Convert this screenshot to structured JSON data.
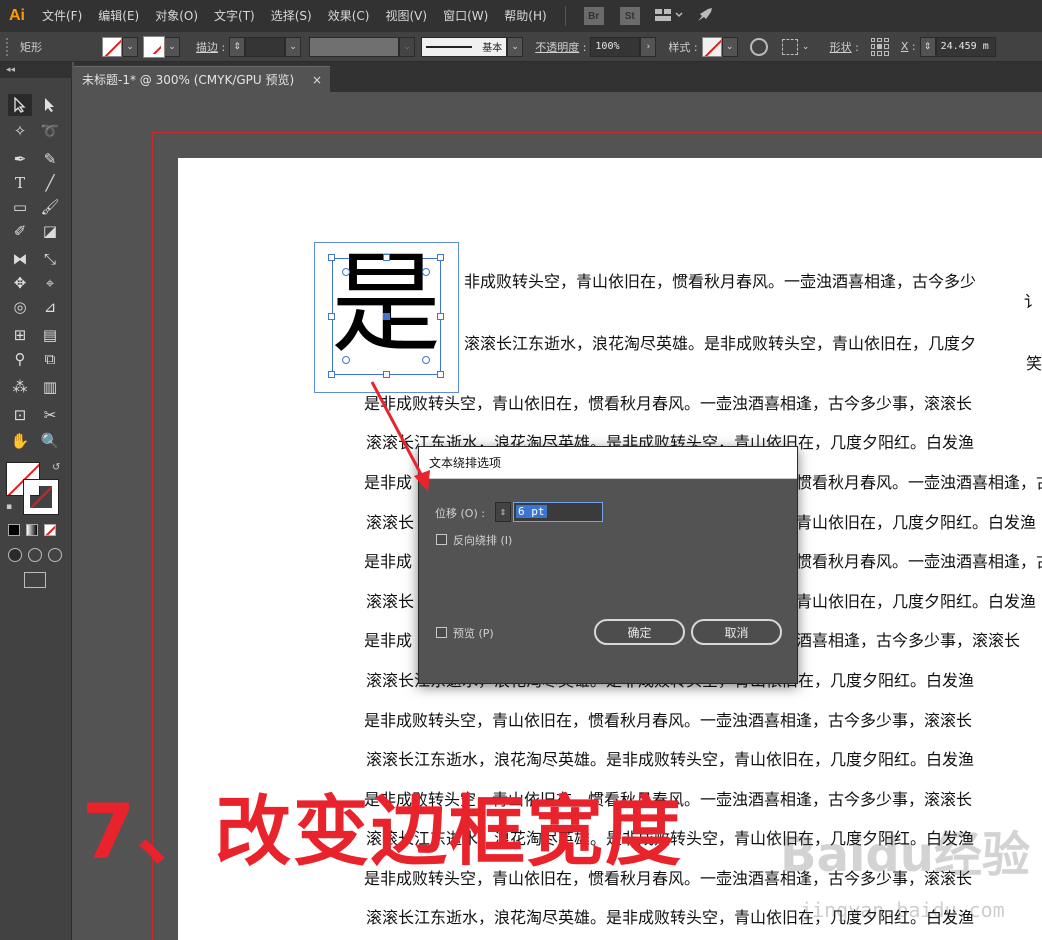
{
  "app": {
    "logo": "Ai"
  },
  "menu": [
    "文件(F)",
    "编辑(E)",
    "对象(O)",
    "文字(T)",
    "选择(S)",
    "效果(C)",
    "视图(V)",
    "窗口(W)",
    "帮助(H)"
  ],
  "app_tiles": {
    "bridge": "Br",
    "stock": "St"
  },
  "controlbar": {
    "object_type": "矩形",
    "stroke_label": "描边",
    "style_preset": "基本",
    "opacity_label": "不透明度",
    "opacity_value": "100%",
    "style_label": "样式",
    "shape_label": "形状",
    "x_label": "X",
    "x_value": "24.459 m"
  },
  "panel_collapse": "◂◂",
  "doc_tab": {
    "title": "未标题-1* @ 300% (CMYK/GPU 预览)",
    "close": "×"
  },
  "big_char": "是",
  "text_lines": [
    "非成败转头空，青山依旧在，惯看秋月春风。一壶浊酒喜相逢，古今多少",
    "讠",
    "滚滚长江东逝水，浪花淘尽英雄。是非成败转头空，青山依旧在，几度夕",
    "笑",
    "是非成败转头空，青山依旧在，惯看秋月春风。一壶浊酒喜相逢，古今多少事，滚滚长",
    "滚滚长江东逝水，浪花淘尽英雄。是非成败转头空，青山依旧在，几度夕阳红。白发渔",
    "是非成",
    "滚滚长",
    "是非成",
    "滚滚长",
    "是非成",
    "滚滚长江东逝水，浪花淘尽英雄。是非成败转头空，青山依旧在，几度夕阳红。白发渔",
    "是非成败转头空，青山依旧在，惯看秋月春风。一壶浊酒喜相逢，古今多少事，滚滚长",
    "滚滚长江东逝水，浪花淘尽英雄。是非成败转头空，青山依旧在，几度夕阳红。白发渔",
    "是非成败转头空，青山依旧在，惯看秋月春风。一壶浊酒喜相逢，古今多少事，滚滚长",
    "滚滚长江东逝水，浪花淘尽英雄。是非成败转头空，青山依旧在，几度夕阳红。白发渔",
    "是非成败转头空，青山依旧在，惯看秋月春风。一壶浊酒喜相逢，古今多少事，滚滚长",
    "滚滚长江东逝水，浪花淘尽英雄。是非成败转头空，青山依旧在，几度夕阳红。白发渔"
  ],
  "right_fragments": [
    "惯看秋月春风。一壶浊酒喜相逢，古今多少事，滚滚长",
    "青山依旧在，几度夕阳红。白发渔",
    "惯看秋月春风。一壶浊酒喜相逢，古今多少事，滚滚长",
    "青山依旧在，几度夕阳红。白发渔",
    "酒喜相逢，古今多少事，滚滚长"
  ],
  "dialog": {
    "title": "文本绕排选项",
    "offset_label": "位移 (O) :",
    "offset_value": "6 pt",
    "invert_label": "反向绕排 (I)",
    "preview_label": "预览 (P)",
    "ok": "确定",
    "cancel": "取消"
  },
  "caption": "7、改变边框宽度",
  "watermark": "Baidu经验",
  "watermark_url": "jingyan.baidu.com",
  "colors": {
    "accent_red": "#e8232c",
    "selection_blue": "#3e74d6",
    "ai_orange": "#ff9a00"
  }
}
